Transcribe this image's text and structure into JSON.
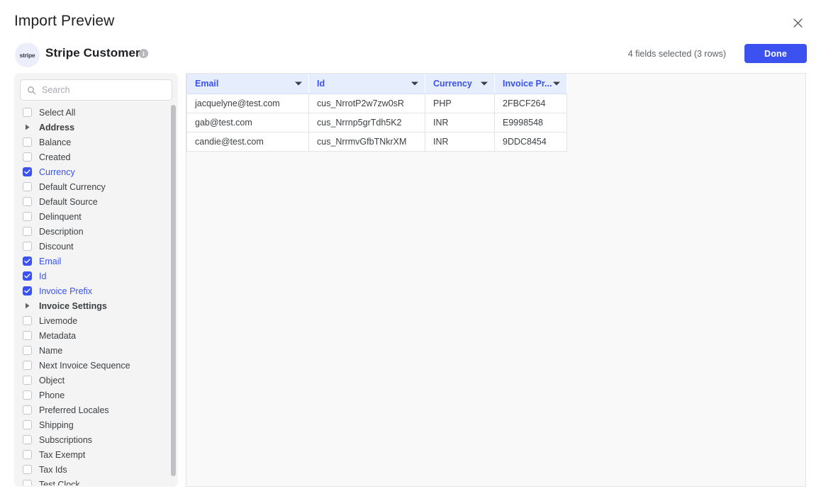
{
  "header": {
    "title": "Import Preview",
    "close_icon": "close-icon"
  },
  "source": {
    "badge_text": "stripe",
    "name": "Stripe Customers",
    "info_icon": "info-icon",
    "info_glyph": "i"
  },
  "toolbar": {
    "status_text": "4 fields selected (3 rows)",
    "done_label": "Done",
    "accent_color": "#3b52f0"
  },
  "search": {
    "placeholder": "Search",
    "value": "",
    "icon": "search-icon"
  },
  "fields": [
    {
      "label": "Select All",
      "type": "checkbox",
      "checked": false
    },
    {
      "label": "Address",
      "type": "group",
      "expanded": false
    },
    {
      "label": "Balance",
      "type": "checkbox",
      "checked": false
    },
    {
      "label": "Created",
      "type": "checkbox",
      "checked": false
    },
    {
      "label": "Currency",
      "type": "checkbox",
      "checked": true
    },
    {
      "label": "Default Currency",
      "type": "checkbox",
      "checked": false
    },
    {
      "label": "Default Source",
      "type": "checkbox",
      "checked": false
    },
    {
      "label": "Delinquent",
      "type": "checkbox",
      "checked": false
    },
    {
      "label": "Description",
      "type": "checkbox",
      "checked": false
    },
    {
      "label": "Discount",
      "type": "checkbox",
      "checked": false
    },
    {
      "label": "Email",
      "type": "checkbox",
      "checked": true
    },
    {
      "label": "Id",
      "type": "checkbox",
      "checked": true
    },
    {
      "label": "Invoice Prefix",
      "type": "checkbox",
      "checked": true
    },
    {
      "label": "Invoice Settings",
      "type": "group",
      "expanded": false
    },
    {
      "label": "Livemode",
      "type": "checkbox",
      "checked": false
    },
    {
      "label": "Metadata",
      "type": "checkbox",
      "checked": false
    },
    {
      "label": "Name",
      "type": "checkbox",
      "checked": false
    },
    {
      "label": "Next Invoice Sequence",
      "type": "checkbox",
      "checked": false
    },
    {
      "label": "Object",
      "type": "checkbox",
      "checked": false
    },
    {
      "label": "Phone",
      "type": "checkbox",
      "checked": false
    },
    {
      "label": "Preferred Locales",
      "type": "checkbox",
      "checked": false
    },
    {
      "label": "Shipping",
      "type": "checkbox",
      "checked": false
    },
    {
      "label": "Subscriptions",
      "type": "checkbox",
      "checked": false
    },
    {
      "label": "Tax Exempt",
      "type": "checkbox",
      "checked": false
    },
    {
      "label": "Tax Ids",
      "type": "checkbox",
      "checked": false
    },
    {
      "label": "Test Clock",
      "type": "checkbox",
      "checked": false
    }
  ],
  "table": {
    "columns": [
      {
        "label": "Email",
        "key": "email",
        "class": "col-email"
      },
      {
        "label": "Id",
        "key": "id",
        "class": "col-id"
      },
      {
        "label": "Currency",
        "key": "currency",
        "class": "col-currency"
      },
      {
        "label": "Invoice Pr...",
        "key": "invoice_prefix",
        "class": "col-prefix"
      }
    ],
    "rows": [
      {
        "email": "jacquelyne@test.com",
        "id": "cus_NrrotP2w7zw0sR",
        "currency": "PHP",
        "invoice_prefix": "2FBCF264"
      },
      {
        "email": "gab@test.com",
        "id": "cus_Nrrnp5grTdh5K2",
        "currency": "INR",
        "invoice_prefix": "E9998548"
      },
      {
        "email": "candie@test.com",
        "id": "cus_NrrmvGfbTNkrXM",
        "currency": "INR",
        "invoice_prefix": "9DDC8454"
      }
    ]
  }
}
